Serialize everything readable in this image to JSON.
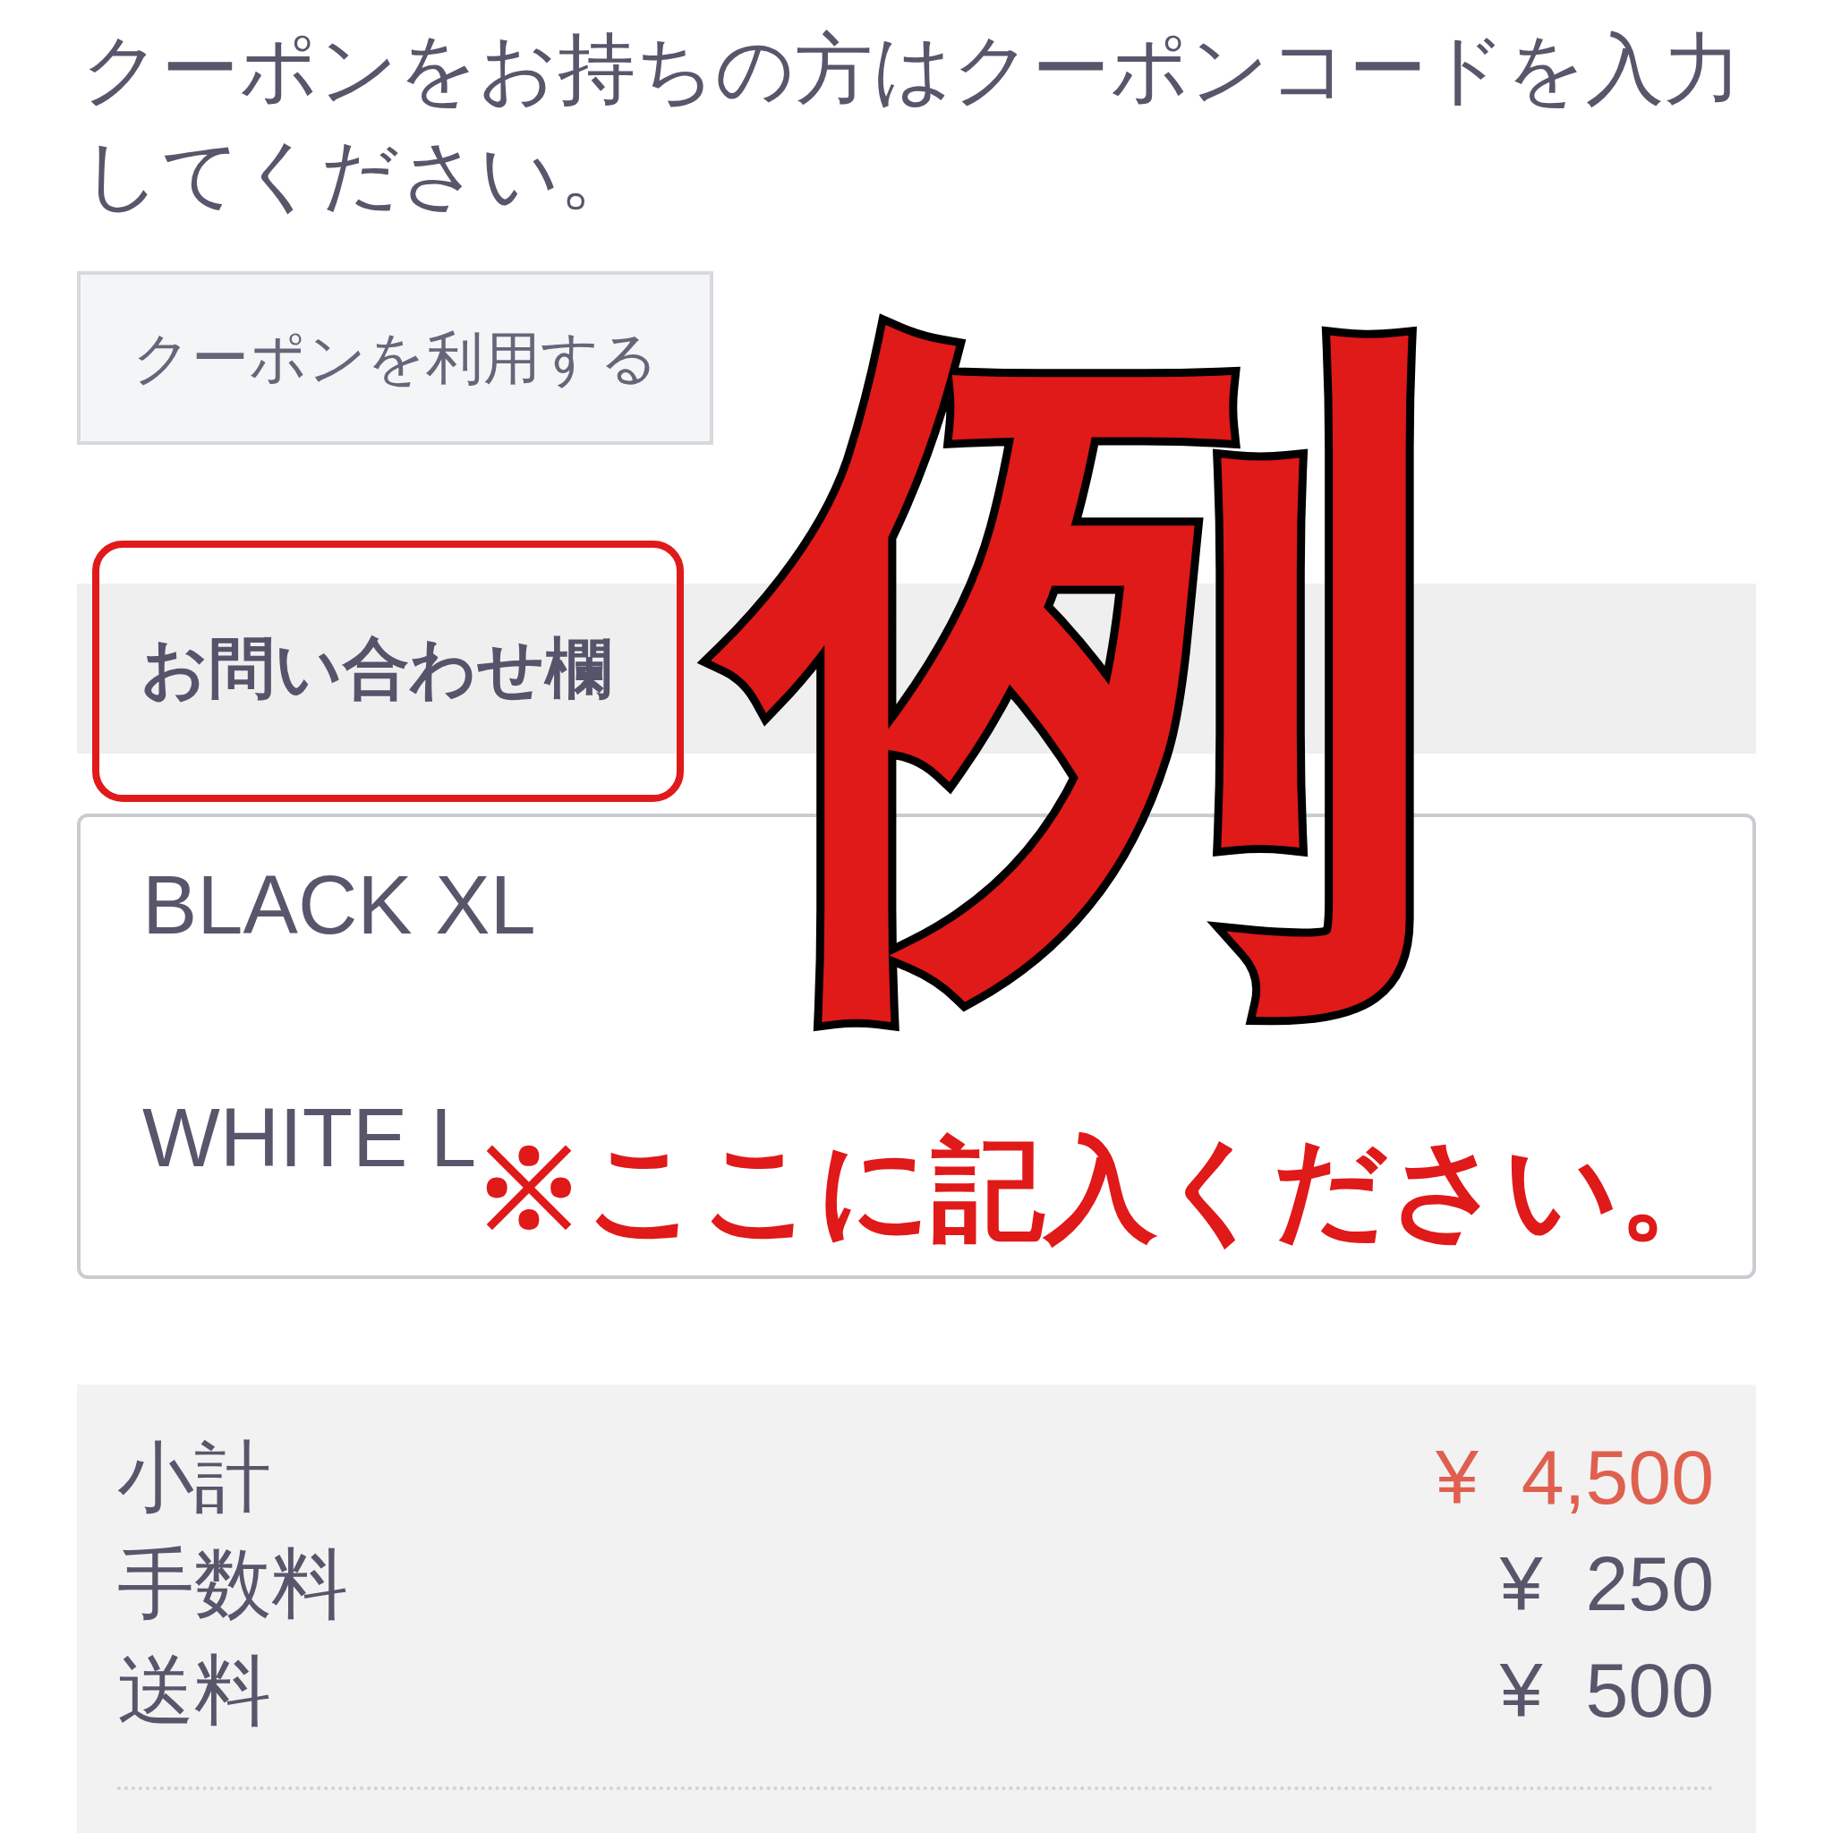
{
  "coupon": {
    "instruction": "クーポンをお持ちの方はクーポンコードを入力してください。",
    "button": "クーポンを利用する"
  },
  "contact": {
    "label": "お問い合わせ欄",
    "highlighted": true,
    "value": "BLACK XL\n\nWHITE L"
  },
  "annotation": {
    "stamp": "例",
    "note": "※ここに記入ください。"
  },
  "summary": {
    "rows": [
      {
        "label": "小計",
        "value": "¥ 4,500",
        "highlighted": true
      },
      {
        "label": "手数料",
        "value": "¥ 250",
        "highlighted": false
      },
      {
        "label": "送料",
        "value": "¥ 500",
        "highlighted": false
      }
    ]
  }
}
